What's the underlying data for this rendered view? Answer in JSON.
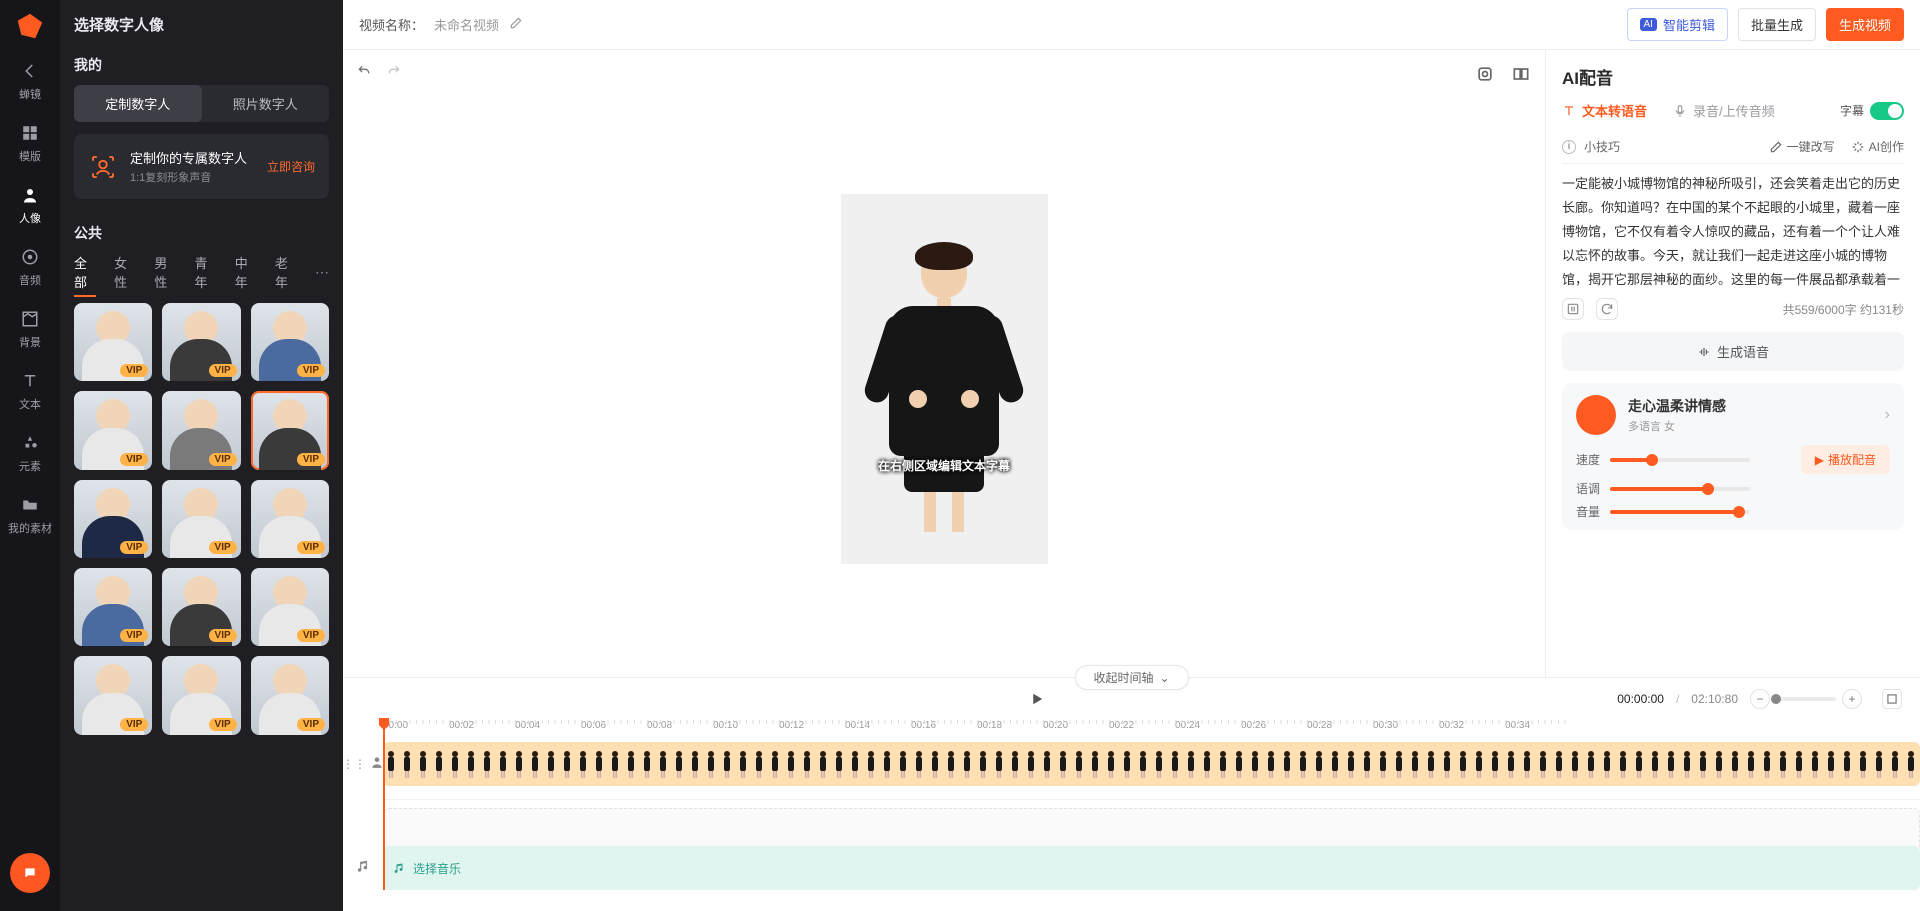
{
  "rail": {
    "back_label": "蝉镜",
    "items": [
      {
        "key": "template",
        "label": "模版"
      },
      {
        "key": "avatar",
        "label": "人像"
      },
      {
        "key": "audio",
        "label": "音频"
      },
      {
        "key": "background",
        "label": "背景"
      },
      {
        "key": "text",
        "label": "文本"
      },
      {
        "key": "element",
        "label": "元素"
      },
      {
        "key": "my_assets",
        "label": "我的素材"
      }
    ]
  },
  "avatar_panel": {
    "title": "选择数字人像",
    "section_mine": "我的",
    "tabs": {
      "custom": "定制数字人",
      "photo": "照片数字人"
    },
    "customize": {
      "line1": "定制你的专属数字人",
      "line2": "1:1复刻形象声音",
      "cta": "立即咨询"
    },
    "section_public": "公共",
    "filters": [
      "全部",
      "女性",
      "男性",
      "青年",
      "中年",
      "老年"
    ],
    "vip_badge": "VIP"
  },
  "topbar": {
    "name_label": "视频名称：",
    "video_name": "未命名视频",
    "ai_clip_chip": "AI",
    "ai_clip": "智能剪辑",
    "batch": "批量生成",
    "generate": "生成视频"
  },
  "canvas": {
    "caption": "在右侧区域编辑文本字幕"
  },
  "right": {
    "title": "AI配音",
    "tab_tts": "文本转语音",
    "tab_rec": "录音/上传音频",
    "subtitle_label": "字幕",
    "tip_label": "小技巧",
    "one_click_rewrite": "一键改写",
    "ai_create": "AI创作",
    "script": "一定能被小城博物馆的神秘所吸引，还会笑着走出它的历史长廊。你知道吗？在中国的某个不起眼的小城里，藏着一座博物馆，它不仅有着令人惊叹的藏品，还有着一个个让人难以忘怀的故事。今天，就让我们一起走进这座小城的博物馆，揭开它那层神秘的面纱。这里的每一件展品都承载着一段厚重的历史，但最让人称奇的是那件被誉为“镇馆之宝”的文物———尊古老的青铜器。这尊青铜器不仅造型",
    "counter": "共559/6000字 约131秒",
    "gen_voice": "生成语音",
    "voice": {
      "name": "走心温柔讲情感",
      "sub": "多语言 女",
      "play": "播放配音",
      "sliders": {
        "speed_label": "速度",
        "speed_pct": 30,
        "pitch_label": "语调",
        "pitch_pct": 70,
        "volume_label": "音量",
        "volume_pct": 92
      }
    }
  },
  "timeline": {
    "collapse": "收起时间轴",
    "current": "00:00:00",
    "total": "02:10:80",
    "ruler": [
      "00:00",
      "00:02",
      "00:04",
      "00:06",
      "00:08",
      "00:10",
      "00:12",
      "00:14",
      "00:16",
      "00:18",
      "00:20",
      "00:22",
      "00:24",
      "00:26",
      "00:28",
      "00:30",
      "00:32",
      "00:34"
    ],
    "music_prompt": "选择音乐"
  }
}
